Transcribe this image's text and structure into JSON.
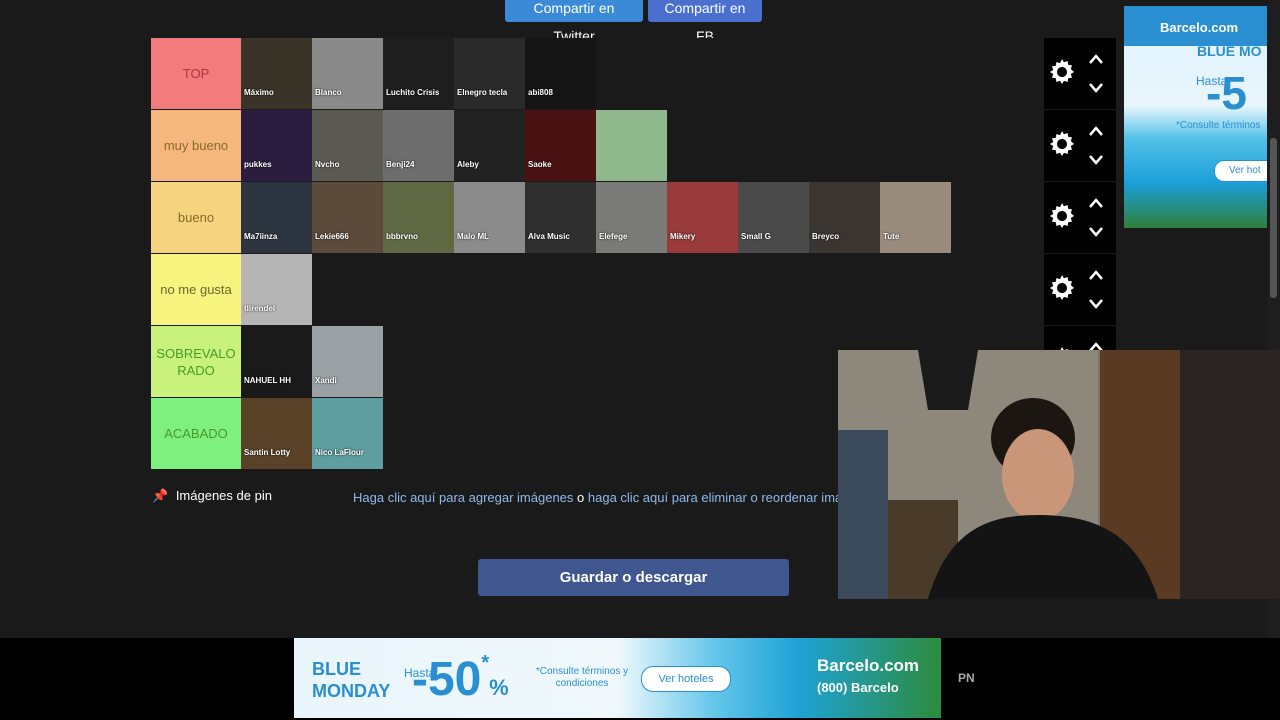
{
  "share": {
    "twitter": "Compartir en Twitter",
    "fb": "Compartir en FB"
  },
  "tiers": [
    {
      "label": "TOP",
      "color": "#f27b7b",
      "items": [
        {
          "name": "Máximo",
          "color": "#3a3428"
        },
        {
          "name": "Blanco",
          "color": "#8a8a8a"
        },
        {
          "name": "Luchito Crisis",
          "color": "#1e1e1e"
        },
        {
          "name": "Elnegro tecla",
          "color": "#2a2a2a"
        },
        {
          "name": "abi808",
          "color": "#151515"
        }
      ]
    },
    {
      "label": "muy bueno",
      "color": "#f5b77d",
      "items": [
        {
          "name": "pukkes",
          "color": "#2b1d3f"
        },
        {
          "name": "Nvcho",
          "color": "#5a5a52"
        },
        {
          "name": "Benji24",
          "color": "#6d6d6d"
        },
        {
          "name": "Aleby",
          "color": "#222"
        },
        {
          "name": "Saoke",
          "color": "#4a1212"
        },
        {
          "name": "",
          "color": "#8fb98c"
        }
      ]
    },
    {
      "label": "bueno",
      "color": "#f5d37f",
      "items": [
        {
          "name": "Ma7iinza",
          "color": "#2c3440"
        },
        {
          "name": "Lekie666",
          "color": "#5c4a3a"
        },
        {
          "name": "bbbrvno",
          "color": "#5f6a45"
        },
        {
          "name": "Malo ML",
          "color": "#8b8b8b"
        },
        {
          "name": "Alva Music",
          "color": "#2f2f2f"
        },
        {
          "name": "Elefege",
          "color": "#7a7a78"
        },
        {
          "name": "Mikery",
          "color": "#9a3a3a"
        },
        {
          "name": "Small G",
          "color": "#4a4a4a"
        },
        {
          "name": "Breyco",
          "color": "#3a3530"
        },
        {
          "name": "Tute",
          "color": "#9a8c7c"
        }
      ]
    },
    {
      "label": "no me gusta",
      "color": "#f7f47f",
      "items": [
        {
          "name": "tlirendel",
          "color": "#b5b5b5"
        }
      ]
    },
    {
      "label": "SOBREVALORADO",
      "color": "#c8f27c",
      "items": [
        {
          "name": "NAHUEL HH",
          "color": "#1a1a1a"
        },
        {
          "name": "Xandi",
          "color": "#9aa2a5"
        }
      ]
    },
    {
      "label": "ACABADO",
      "color": "#7ef07e",
      "items": [
        {
          "name": "Santin Lotty",
          "color": "#5a4228"
        },
        {
          "name": "Nico LaFlour",
          "color": "#5f9ea0"
        }
      ]
    }
  ],
  "pin": {
    "icon": "pushpin-icon",
    "label": "Imágenes de pin"
  },
  "help": {
    "link_add": "Haga clic aquí para agregar imágenes",
    "connector": " o ",
    "link_remove": "haga clic aquí para eliminar o reordenar imá"
  },
  "save_label": "Guardar o descargar",
  "right_ad": {
    "brand": "Barcelo.com",
    "headline": "BLUE MO",
    "hasta": "Hasta",
    "percent": "-5",
    "conditions": "*Consulte términos",
    "cta": "Ver hot"
  },
  "bottom_ad": {
    "line1": "BLUE",
    "line2": "MONDAY",
    "hasta": "Hasta",
    "percent": "-50",
    "percent_sign": "%",
    "asterisk": "*",
    "conditions": "*Consulte términos y condiciones",
    "cta": "Ver hoteles",
    "brand": "Barcelo.com",
    "phone": "(800) Barcelo"
  },
  "bottom_label": "PN"
}
